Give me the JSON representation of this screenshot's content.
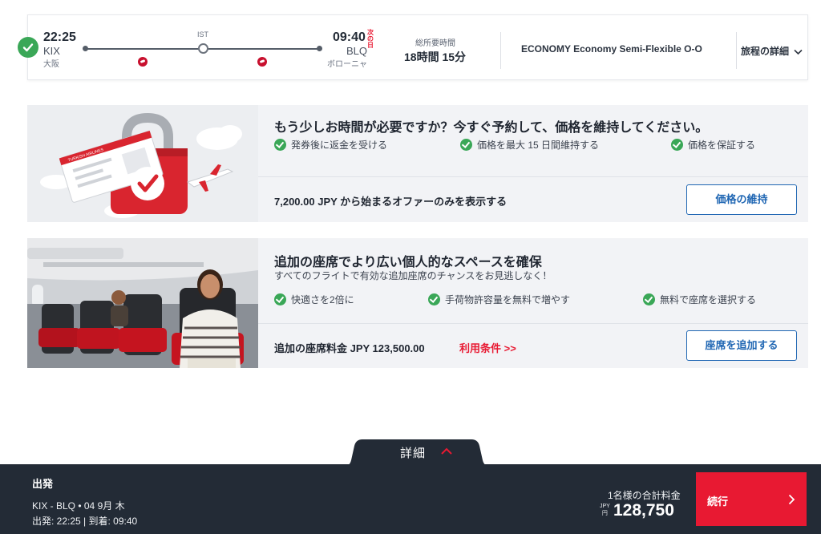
{
  "flight": {
    "departure": {
      "time": "22:25",
      "code": "KIX",
      "city": "大阪"
    },
    "stop": "IST",
    "arrival": {
      "time": "09:40",
      "next_day": "次の日",
      "code": "BLQ",
      "city": "ボローニャ"
    },
    "duration_label": "総所要時間",
    "duration": "18時間 15分",
    "fare": "ECONOMY Economy Semi-Flexible O-O",
    "details_link": "旅程の詳細"
  },
  "price_hold": {
    "title": "もう少しお時間が必要ですか？今すぐ予約して、価格を維持してください。",
    "benefits": [
      "発券後に返金を受ける",
      "価格を最大 15 日間維持する",
      "価格を保証する"
    ],
    "price_text": "7,200.00 JPY から始まるオファーのみを表示する",
    "button": "価格の維持",
    "ticket_brand": "TURKISH AIRLINES"
  },
  "extra_seat": {
    "title": "追加の座席でより広い個人的なスペースを確保",
    "subtitle": "すべてのフライトで有効な追加座席のチャンスをお見逃しなく！",
    "benefits": [
      "快適さを2倍に",
      "手荷物許容量を無料で増やす",
      "無料で座席を選択する"
    ],
    "price_text": "追加の座席料金 JPY 123,500.00",
    "terms_link": "利用条件 >>",
    "button": "座席を追加する"
  },
  "footer": {
    "detail_tab": "詳細",
    "label": "出発",
    "route": "KIX  -  BLQ  •  04 9月 木",
    "times": "出発: 22:25 | 到着: 09:40",
    "total_label": "1名様の合計料金",
    "currency": "JPY",
    "currency_yen": "円",
    "amount": "128,750",
    "continue": "続行"
  },
  "colors": {
    "accent_red": "#e81932",
    "link_blue": "#1f66b3",
    "success_green": "#3aa757",
    "footer_bg": "#232b36"
  }
}
